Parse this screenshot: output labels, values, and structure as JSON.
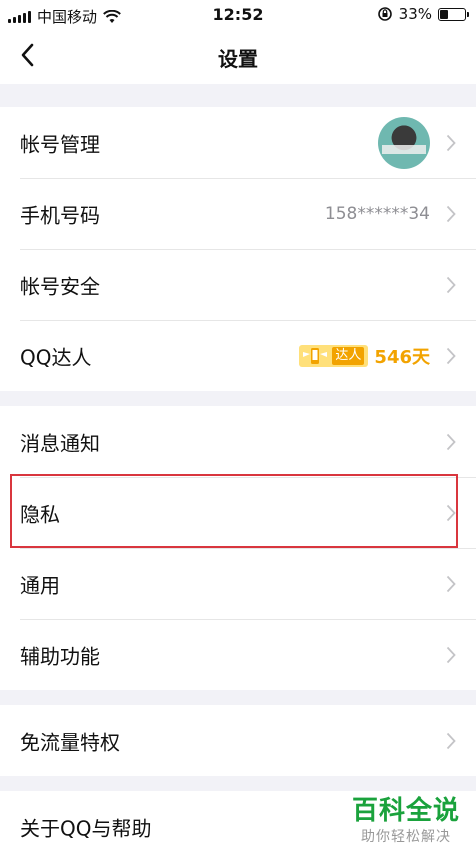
{
  "status_bar": {
    "carrier": "中国移动",
    "time": "12:52",
    "battery": "33%",
    "battery_level": 0.33
  },
  "header": {
    "title": "设置"
  },
  "groups": [
    {
      "items": [
        {
          "label": "帐号管理"
        },
        {
          "label": "手机号码",
          "value": "158******34"
        },
        {
          "label": "帐号安全"
        },
        {
          "label": "QQ达人",
          "badge": "达人",
          "days": "546天"
        }
      ]
    },
    {
      "items": [
        {
          "label": "消息通知"
        },
        {
          "label": "隐私"
        },
        {
          "label": "通用"
        },
        {
          "label": "辅助功能"
        }
      ]
    },
    {
      "items": [
        {
          "label": "免流量特权"
        }
      ]
    },
    {
      "items": [
        {
          "label": "关于QQ与帮助"
        }
      ]
    }
  ],
  "watermark": {
    "main": "百科全说",
    "sub": "助你轻松解决"
  },
  "colors": {
    "highlight": "#d9363e",
    "vip": "#f2a300",
    "watermark": "#1aa23c"
  }
}
